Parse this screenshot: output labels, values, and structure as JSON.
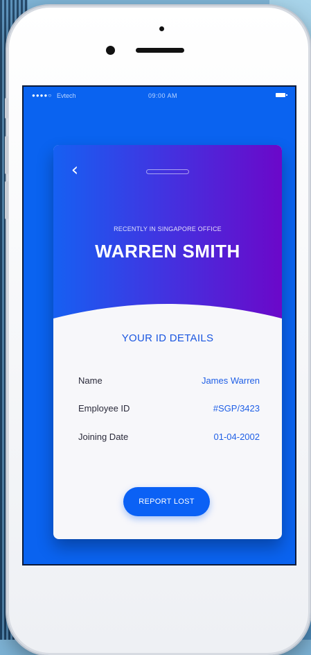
{
  "status_bar": {
    "signal": "●●●●○",
    "carrier": "Evtech",
    "time": "09:00 AM"
  },
  "card": {
    "subtitle": "RECENTLY IN SINGAPORE OFFICE",
    "name": "WARREN SMITH",
    "section_title": "YOUR ID DETAILS",
    "details": [
      {
        "label": "Name",
        "value": "James Warren"
      },
      {
        "label": "Employee ID",
        "value": "#SGP/3423"
      },
      {
        "label": "Joining Date",
        "value": "01-04-2002"
      }
    ],
    "report_button": "REPORT LOST"
  },
  "colors": {
    "accent": "#0b61f5",
    "header_start": "#1660f2",
    "header_end": "#6b08c9"
  }
}
